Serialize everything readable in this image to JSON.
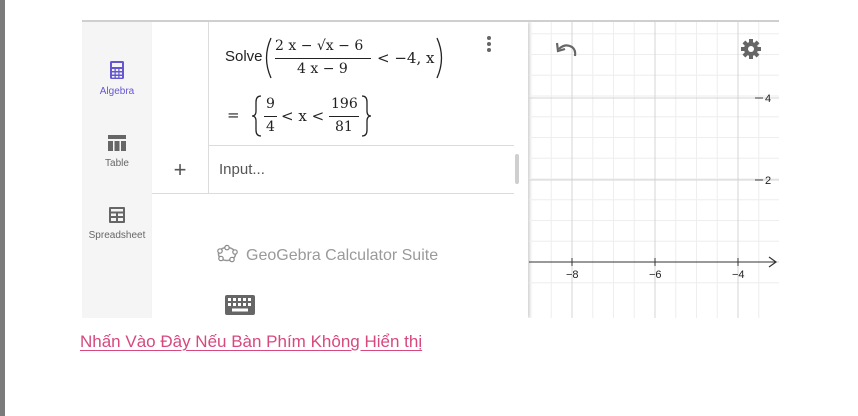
{
  "sidebar": {
    "items": [
      {
        "label": "Algebra",
        "active": true,
        "icon": "calculator-icon"
      },
      {
        "label": "Table",
        "active": false,
        "icon": "table-icon"
      },
      {
        "label": "Spreadsheet",
        "active": false,
        "icon": "spreadsheet-icon"
      }
    ]
  },
  "algebra": {
    "command_name": "Solve",
    "numerator": "2 x − √x − 6",
    "denominator": "4 x − 9",
    "inequality_rest": "< −4, x",
    "equals": "=",
    "result_left_num": "9",
    "result_left_den": "4",
    "result_middle": "< x <",
    "result_right_num": "196",
    "result_right_den": "81",
    "input_placeholder": "Input...",
    "plus_label": "+"
  },
  "suite_label": "GeoGebra Calculator Suite",
  "graphics": {
    "y_tick_labels": [
      "4",
      "2"
    ],
    "x_tick_labels": [
      "−8",
      "−6",
      "−4"
    ]
  },
  "link_text": "Nhấn Vào Đây Nếu Bàn Phím Không Hiển thị",
  "colors": {
    "accent": "#6557d2",
    "link": "#d7487f",
    "grid_minor": "#eeeeee",
    "grid_major": "#d4d4d4"
  }
}
